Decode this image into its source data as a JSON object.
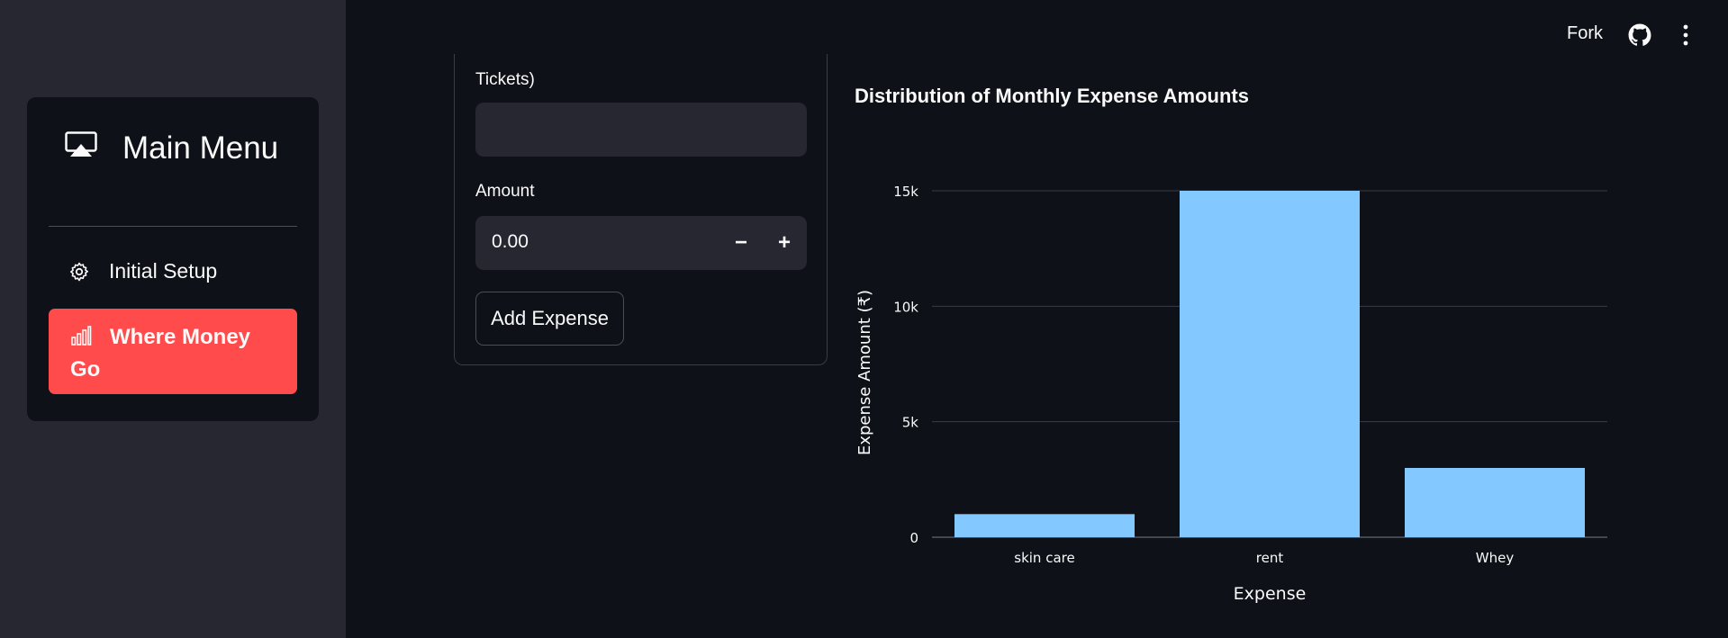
{
  "sidebar": {
    "title": "Main Menu",
    "items": [
      {
        "label": "Initial Setup",
        "icon": "gear-icon",
        "active": false
      },
      {
        "label": "Where Money Go",
        "icon": "bar-chart-icon",
        "active": true
      }
    ],
    "active_color": "#ff4b4b"
  },
  "header": {
    "fork_label": "Fork"
  },
  "form": {
    "partial_label": "Tickets)",
    "text_value": "",
    "amount_label": "Amount",
    "amount_value": "0.00",
    "minus_label": "−",
    "plus_label": "+",
    "add_button": "Add Expense"
  },
  "chart_data": {
    "type": "bar",
    "title": "Distribution of Monthly Expense Amounts",
    "xlabel": "Expense",
    "ylabel": "Expense Amount (₹)",
    "categories": [
      "skin care",
      "rent",
      "Whey"
    ],
    "values": [
      1000,
      15000,
      3000
    ],
    "ylim": [
      0,
      15000
    ],
    "yticks": [
      0,
      5000,
      10000,
      15000
    ],
    "ytick_labels": [
      "0",
      "5k",
      "10k",
      "15k"
    ],
    "bar_color": "#83c9ff",
    "grid": true
  }
}
